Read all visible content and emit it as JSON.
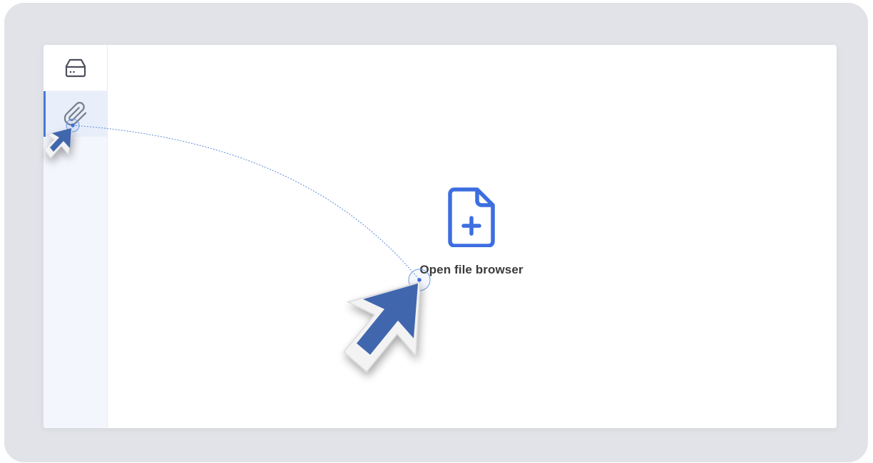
{
  "sidebar": {
    "items": [
      {
        "icon": "hard-drive-icon",
        "active": false
      },
      {
        "icon": "paperclip-icon",
        "active": true
      }
    ]
  },
  "main": {
    "action": {
      "icon": "file-plus-icon",
      "label": "Open file browser"
    }
  },
  "colors": {
    "accent": "#3d6ee0",
    "sidebar_bg": "#f4f6fd",
    "frame_bg": "#e1e3e8",
    "cursor_blue": "#3f66ad"
  }
}
